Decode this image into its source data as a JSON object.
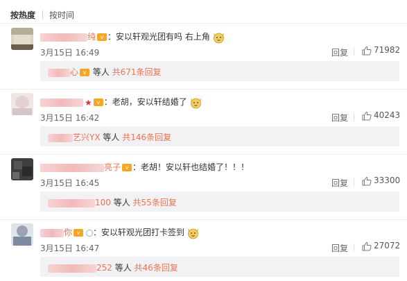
{
  "tabs": {
    "hot": "按热度",
    "time": "按时间"
  },
  "actions": {
    "reply": "回复"
  },
  "colors": {
    "accent": "#eb7350",
    "reply_bg": "#f2f2f5",
    "badge": "#f5a623"
  },
  "comments": [
    {
      "name_tail": "纯",
      "text": "：安以轩观光团有吗 右上角",
      "emoji": "dog-emoji",
      "date": "3月15日 16:49",
      "likes": "71982",
      "reply_name_tail": "心",
      "reply_who": " 等人 ",
      "reply_count": "共671条回复"
    },
    {
      "name_tail": "",
      "text": "：老胡，安以轩结婚了",
      "emoji": "dog-emoji",
      "date": "3月15日 16:42",
      "likes": "40243",
      "reply_name_tail": "艺兴YX",
      "reply_who": " 等人 ",
      "reply_count": "共146条回复"
    },
    {
      "name_tail": "亮子",
      "text": "：老胡！安以轩也结婚了！！！",
      "emoji": "",
      "date": "3月15日 16:45",
      "likes": "33300",
      "reply_name_tail": "100",
      "reply_who": " 等人 ",
      "reply_count": "共55条回复"
    },
    {
      "name_tail": "你",
      "text": "：安以轩观光团打卡签到",
      "emoji": "dog-emoji",
      "date": "3月15日 16:47",
      "likes": "27072",
      "reply_name_tail": "252",
      "reply_who": " 等人 ",
      "reply_count": "共46条回复"
    }
  ]
}
